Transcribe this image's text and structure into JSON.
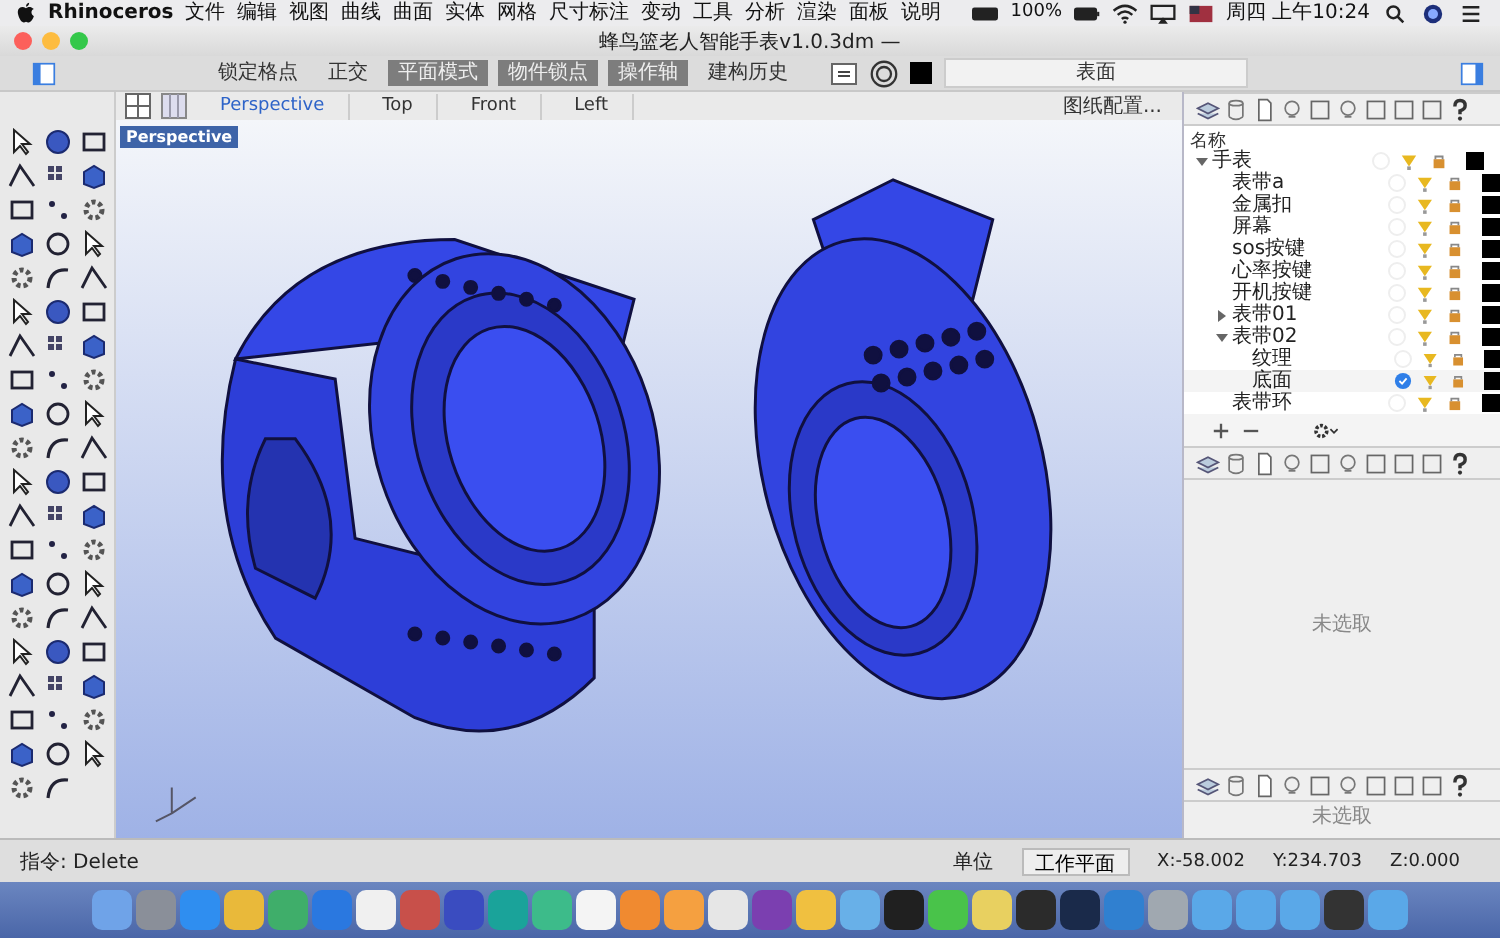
{
  "menubar": {
    "app": "Rhinoceros",
    "menus": [
      "文件",
      "编辑",
      "视图",
      "曲线",
      "曲面",
      "实体",
      "网格",
      "尺寸标注",
      "变动",
      "工具",
      "分析",
      "渲染",
      "面板",
      "说明"
    ],
    "battery": "100%",
    "clock": "周四 上午10:24"
  },
  "window": {
    "title": "蜂鸟篮老人智能手表v1.0.3dm —"
  },
  "toolbar": {
    "toggles": [
      {
        "label": "锁定格点",
        "on": false
      },
      {
        "label": "正交",
        "on": false
      },
      {
        "label": "平面模式",
        "on": true
      },
      {
        "label": "物件锁点",
        "on": true
      },
      {
        "label": "操作轴",
        "on": true
      },
      {
        "label": "建构历史",
        "on": false
      }
    ],
    "layer_field": "表面"
  },
  "viewport_tabs": [
    {
      "label": "Perspective",
      "selected": true
    },
    {
      "label": "Top",
      "selected": false
    },
    {
      "label": "Front",
      "selected": false
    },
    {
      "label": "Left",
      "selected": false
    }
  ],
  "layout_button": "图纸配置...",
  "viewport": {
    "label": "Perspective"
  },
  "layers": {
    "header": "名称",
    "tree": [
      {
        "name": "手表",
        "expanded": true,
        "current": false,
        "children": [
          {
            "name": "表带a",
            "current": false
          },
          {
            "name": "金属扣",
            "current": false
          },
          {
            "name": "屏幕",
            "current": false
          },
          {
            "name": "sos按键",
            "current": false
          },
          {
            "name": "心率按键",
            "current": false
          },
          {
            "name": "开机按键",
            "current": false
          },
          {
            "name": "表带01",
            "expanded": false,
            "current": false
          },
          {
            "name": "表带02",
            "expanded": true,
            "current": false,
            "children": [
              {
                "name": "纹理",
                "current": false
              },
              {
                "name": "底面",
                "current": true
              }
            ]
          },
          {
            "name": "表带环",
            "current": false
          }
        ]
      }
    ]
  },
  "properties_panels": [
    {
      "message": "未选取"
    },
    {
      "message": "未选取"
    }
  ],
  "status_bar": {
    "command": "指令: Delete",
    "units_label": "单位",
    "cplane_button": "工作平面",
    "x": "X:-58.002",
    "y": "Y:234.703",
    "z": "Z:0.000"
  }
}
